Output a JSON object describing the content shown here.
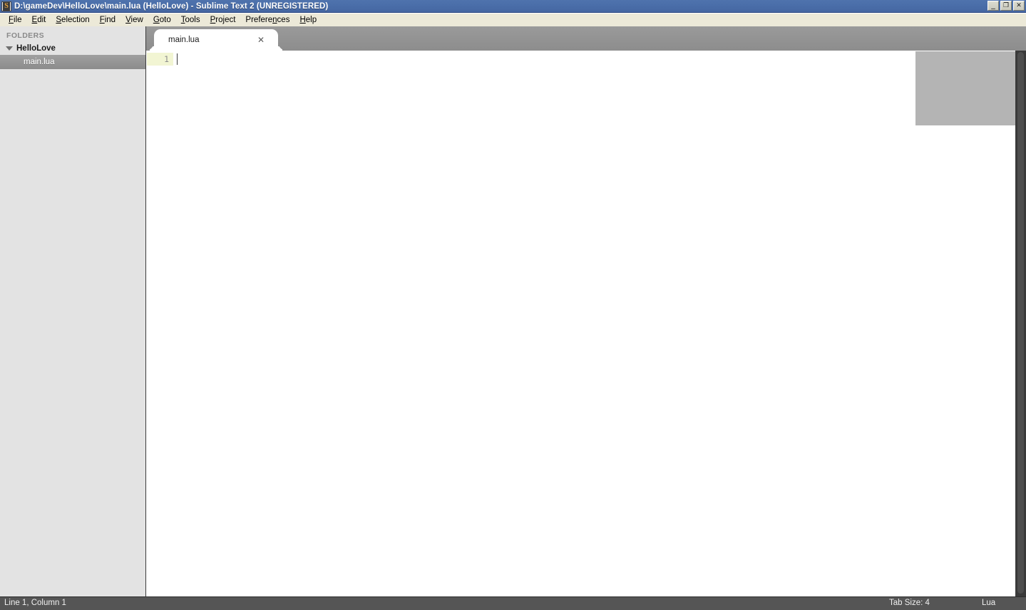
{
  "window": {
    "title": "D:\\gameDev\\HelloLove\\main.lua (HelloLove) - Sublime Text 2 (UNREGISTERED)",
    "icon": "sublime-text-icon",
    "icon_glyph": "S",
    "controls": {
      "minimize": "_",
      "maximize": "❐",
      "close": "✕"
    },
    "titlebar_color": "#4a6ea9"
  },
  "menubar": {
    "items": [
      {
        "label": "File",
        "accesskey": "F"
      },
      {
        "label": "Edit",
        "accesskey": "E"
      },
      {
        "label": "Selection",
        "accesskey": "S"
      },
      {
        "label": "Find",
        "accesskey": "F"
      },
      {
        "label": "View",
        "accesskey": "V"
      },
      {
        "label": "Goto",
        "accesskey": "G"
      },
      {
        "label": "Tools",
        "accesskey": "T"
      },
      {
        "label": "Project",
        "accesskey": "P"
      },
      {
        "label": "Preferences",
        "accesskey": "n"
      },
      {
        "label": "Help",
        "accesskey": "H"
      }
    ]
  },
  "sidebar": {
    "header": "FOLDERS",
    "folder": {
      "name": "HelloLove",
      "expanded": true,
      "toggle_icon": "triangle-down-icon"
    },
    "files": [
      {
        "name": "main.lua",
        "selected": true
      }
    ],
    "background_color": "#e3e3e3"
  },
  "tabs": [
    {
      "label": "main.lua",
      "active": true,
      "close_icon": "close-icon",
      "close_glyph": "✕"
    }
  ],
  "editor": {
    "line_numbers": [
      "1"
    ],
    "content": "",
    "active_line_highlight": "#f2f5d3",
    "background_color": "#ffffff",
    "caret_visible": true
  },
  "minimap": {
    "viewport_color": "#b4b4b4",
    "visible": true
  },
  "scrollbar": {
    "track_color": "#3a3a3a",
    "thumb_color": "#4e4e4e",
    "orientation": "vertical"
  },
  "statusbar": {
    "position": "Line 1, Column 1",
    "tab_size": "Tab Size: 4",
    "syntax": "Lua",
    "background_color": "#555555"
  }
}
